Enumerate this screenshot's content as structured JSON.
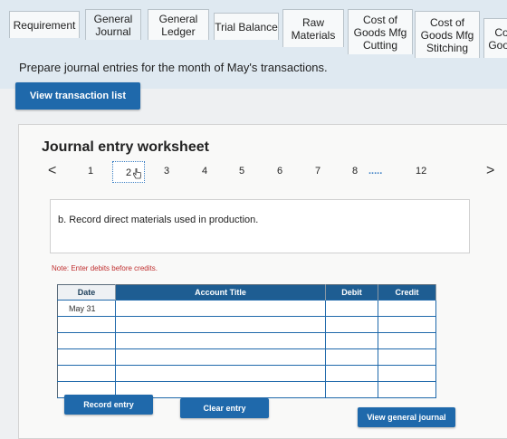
{
  "tabs": [
    {
      "label": "Requirement",
      "active": false
    },
    {
      "label": "General\nJournal",
      "active": true
    },
    {
      "label": "General\nLedger",
      "active": false
    },
    {
      "label": "Trial Balance",
      "active": false
    },
    {
      "label": "Raw\nMaterials",
      "active": false
    },
    {
      "label": "Cost of\nGoods Mfg\nCutting",
      "active": false
    },
    {
      "label": "Cost of\nGoods Mfg\nStitching",
      "active": false
    },
    {
      "label": "Co\nGood",
      "active": false
    }
  ],
  "instruction": "Prepare journal entries for the month of May's transactions.",
  "view_transaction_list": "View transaction list",
  "worksheet": {
    "title": "Journal entry worksheet",
    "pager": {
      "prev": "<",
      "next": ">",
      "pages": [
        "1",
        "2",
        "3",
        "4",
        "5",
        "6",
        "7",
        "8",
        ".....",
        "12"
      ],
      "current": "2"
    },
    "entry_description": "b. Record direct materials used in production.",
    "note": "Note: Enter debits before credits.",
    "columns": {
      "date": "Date",
      "account": "Account Title",
      "debit": "Debit",
      "credit": "Credit"
    },
    "rows": [
      {
        "date": "May 31",
        "account": "",
        "debit": "",
        "credit": ""
      },
      {
        "date": "",
        "account": "",
        "debit": "",
        "credit": ""
      },
      {
        "date": "",
        "account": "",
        "debit": "",
        "credit": ""
      },
      {
        "date": "",
        "account": "",
        "debit": "",
        "credit": ""
      },
      {
        "date": "",
        "account": "",
        "debit": "",
        "credit": ""
      },
      {
        "date": "",
        "account": "",
        "debit": "",
        "credit": ""
      }
    ],
    "buttons": {
      "record": "Record entry",
      "clear": "Clear entry",
      "view_general_journal": "View general journal"
    }
  },
  "colors": {
    "accent": "#1f69ab",
    "header_blue": "#1e5d92",
    "note_red": "#c03030"
  }
}
